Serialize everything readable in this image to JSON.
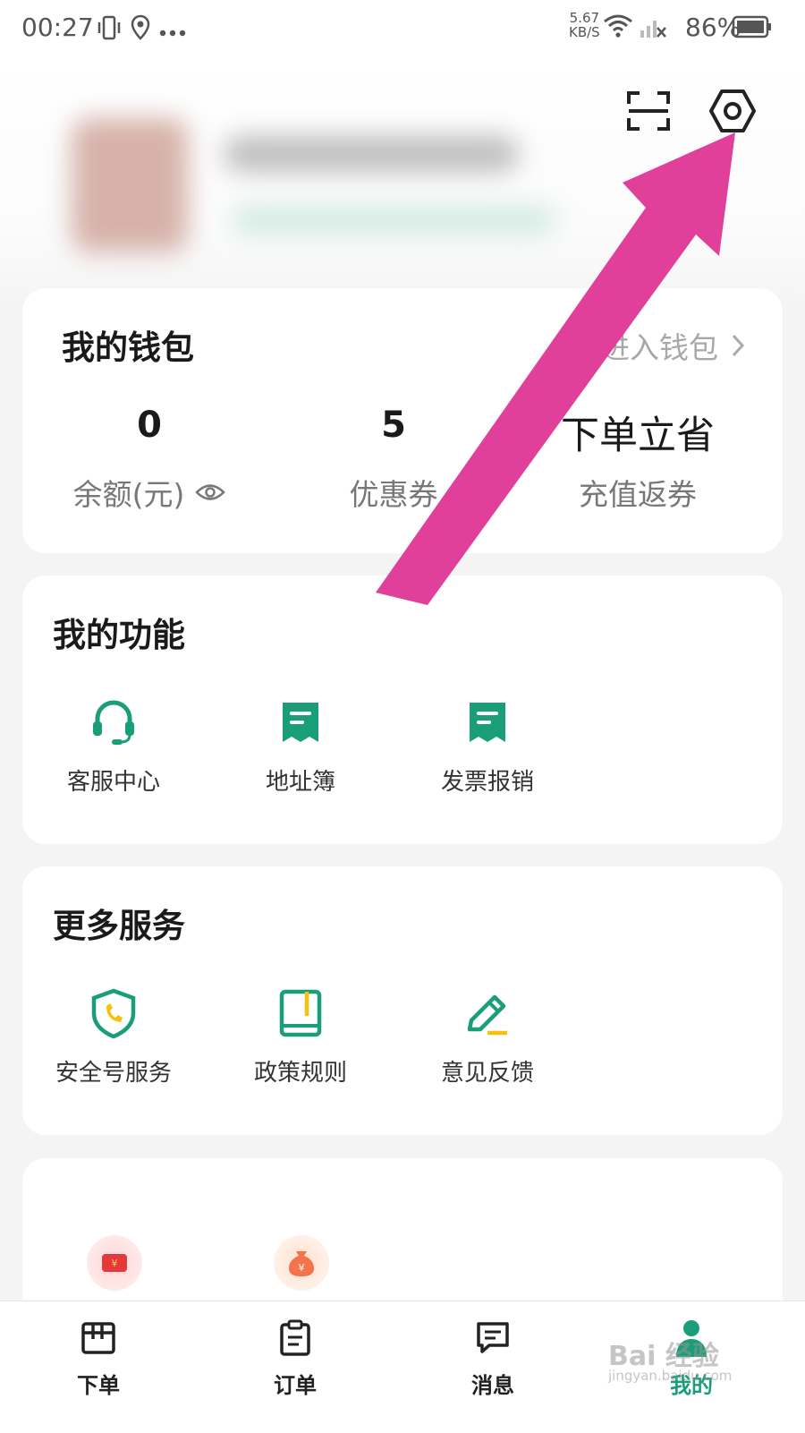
{
  "status_bar": {
    "time": "00:27",
    "speed_value": "5.67",
    "speed_unit": "KB/S",
    "battery": "86%"
  },
  "header": {
    "scan_icon": "scan-icon",
    "settings_icon": "settings-icon"
  },
  "wallet": {
    "title": "我的钱包",
    "link_label": "进入钱包",
    "items": [
      {
        "value": "0",
        "label": "余额(元)"
      },
      {
        "value": "5",
        "label": "优惠券"
      },
      {
        "value": "下单立省",
        "label": "充值返券"
      }
    ]
  },
  "functions": {
    "title": "我的功能",
    "items": [
      {
        "label": "客服中心",
        "icon": "headset-icon"
      },
      {
        "label": "地址簿",
        "icon": "address-book-icon"
      },
      {
        "label": "发票报销",
        "icon": "invoice-icon"
      }
    ]
  },
  "services": {
    "title": "更多服务",
    "items": [
      {
        "label": "安全号服务",
        "icon": "shield-phone-icon"
      },
      {
        "label": "政策规则",
        "icon": "rules-book-icon"
      },
      {
        "label": "意见反馈",
        "icon": "feedback-pencil-icon"
      }
    ]
  },
  "tabbar": {
    "items": [
      {
        "label": "下单",
        "icon": "order-board-icon"
      },
      {
        "label": "订单",
        "icon": "clipboard-icon"
      },
      {
        "label": "消息",
        "icon": "message-icon"
      },
      {
        "label": "我的",
        "icon": "profile-icon"
      }
    ]
  },
  "colors": {
    "accent": "#1a9e7a",
    "arrow": "#e0409a",
    "yellow": "#f5c10a"
  },
  "watermark": {
    "text": "Bai 经验",
    "sub": "jingyan.baidu.com"
  }
}
